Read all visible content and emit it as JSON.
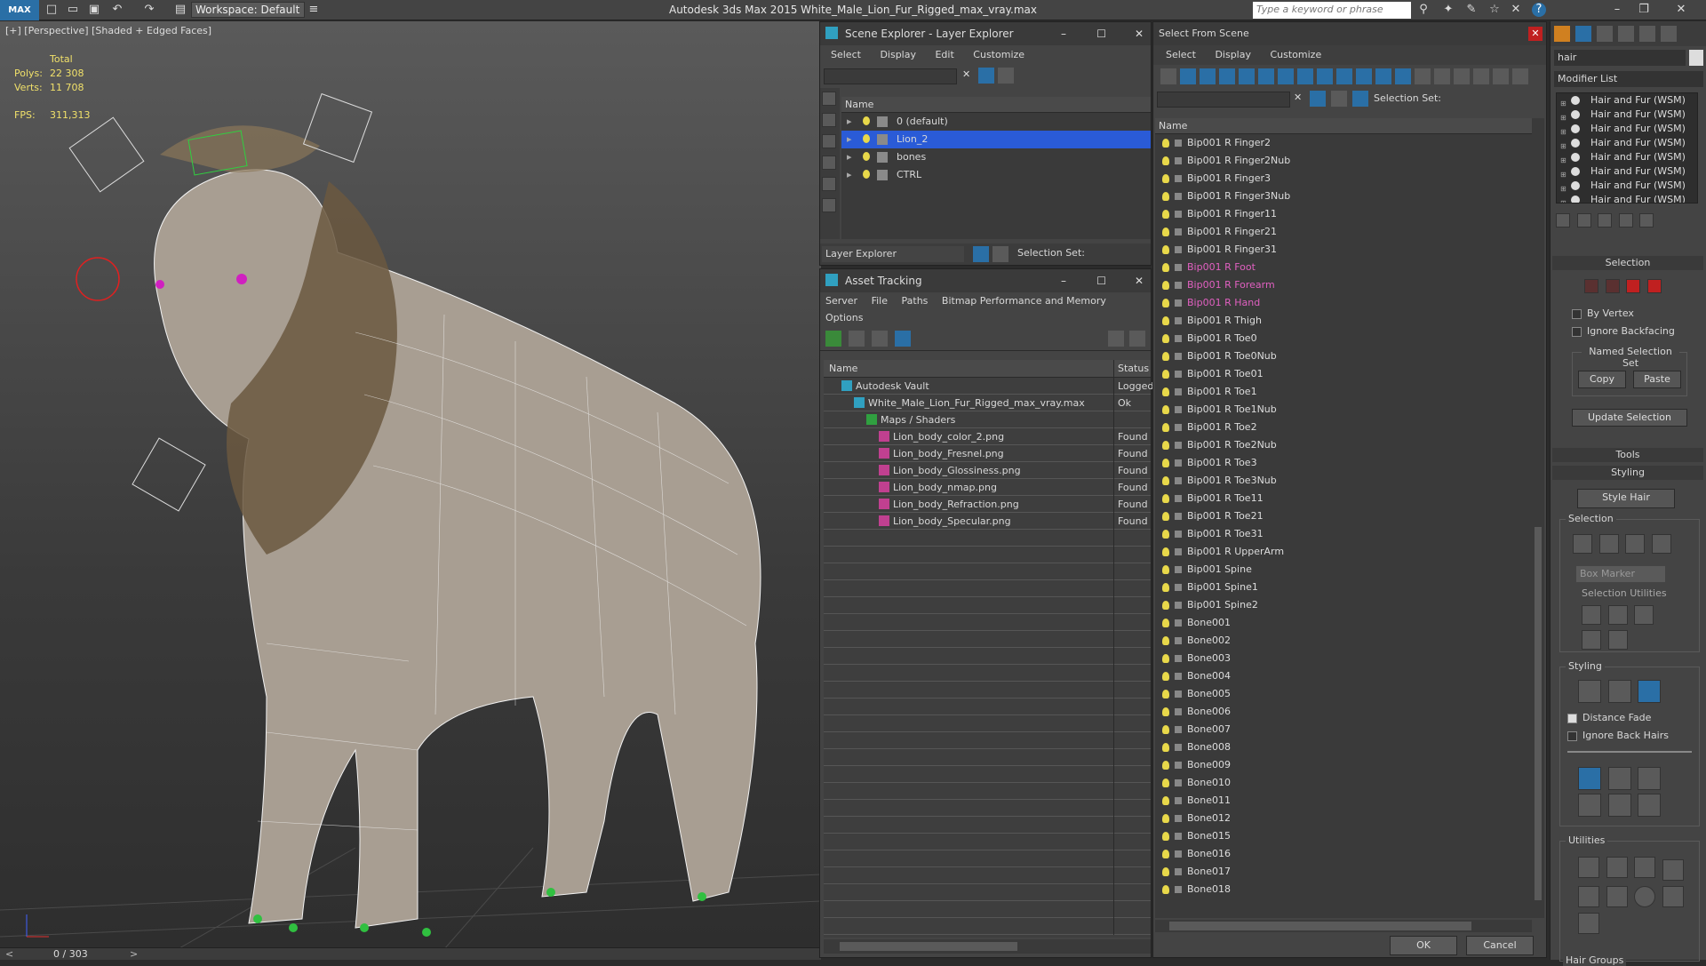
{
  "app": {
    "title": "Autodesk 3ds Max  2015     White_Male_Lion_Fur_Rigged_max_vray.max",
    "logo": "MAX",
    "workspace": "Workspace: Default",
    "search_placeholder": "Type a keyword or phrase"
  },
  "viewport": {
    "label": "[+] [Perspective] [Shaded + Edged Faces]",
    "stats": {
      "total_label": "Total",
      "polys_label": "Polys:",
      "polys": "22 308",
      "verts_label": "Verts:",
      "verts": "11 708",
      "fps_label": "FPS:",
      "fps": "311,313"
    },
    "timeline": "0 / 303"
  },
  "scene_explorer": {
    "title": "Scene Explorer - Layer Explorer",
    "menu": [
      "Select",
      "Display",
      "Edit",
      "Customize"
    ],
    "column": "Name",
    "layers": [
      {
        "name": "0 (default)",
        "selected": false
      },
      {
        "name": "Lion_2",
        "selected": true
      },
      {
        "name": "bones",
        "selected": false
      },
      {
        "name": "CTRL",
        "selected": false
      }
    ],
    "footer_dropdown": "Layer Explorer",
    "selection_set": "Selection Set:"
  },
  "asset_tracking": {
    "title": "Asset Tracking",
    "menu": [
      "Server",
      "File",
      "Paths",
      "Bitmap Performance and Memory"
    ],
    "menu2": "Options",
    "columns": [
      "Name",
      "Status"
    ],
    "rows": [
      {
        "name": "Autodesk Vault",
        "status": "Logged",
        "indent": 1
      },
      {
        "name": "White_Male_Lion_Fur_Rigged_max_vray.max",
        "status": "Ok",
        "indent": 2
      },
      {
        "name": "Maps / Shaders",
        "status": "",
        "indent": 3
      },
      {
        "name": "Lion_body_color_2.png",
        "status": "Found",
        "indent": 4
      },
      {
        "name": "Lion_body_Fresnel.png",
        "status": "Found",
        "indent": 4
      },
      {
        "name": "Lion_body_Glossiness.png",
        "status": "Found",
        "indent": 4
      },
      {
        "name": "Lion_body_nmap.png",
        "status": "Found",
        "indent": 4
      },
      {
        "name": "Lion_body_Refraction.png",
        "status": "Found",
        "indent": 4
      },
      {
        "name": "Lion_body_Specular.png",
        "status": "Found",
        "indent": 4
      }
    ]
  },
  "select_from_scene": {
    "title": "Select From Scene",
    "menu": [
      "Select",
      "Display",
      "Customize"
    ],
    "selection_set": "Selection Set:",
    "column": "Name",
    "items": [
      {
        "name": "Bip001 R Finger2",
        "hl": false
      },
      {
        "name": "Bip001 R Finger2Nub",
        "hl": false
      },
      {
        "name": "Bip001 R Finger3",
        "hl": false
      },
      {
        "name": "Bip001 R Finger3Nub",
        "hl": false
      },
      {
        "name": "Bip001 R Finger11",
        "hl": false
      },
      {
        "name": "Bip001 R Finger21",
        "hl": false
      },
      {
        "name": "Bip001 R Finger31",
        "hl": false
      },
      {
        "name": "Bip001 R Foot",
        "hl": true
      },
      {
        "name": "Bip001 R Forearm",
        "hl": true
      },
      {
        "name": "Bip001 R Hand",
        "hl": true
      },
      {
        "name": "Bip001 R Thigh",
        "hl": false
      },
      {
        "name": "Bip001 R Toe0",
        "hl": false
      },
      {
        "name": "Bip001 R Toe0Nub",
        "hl": false
      },
      {
        "name": "Bip001 R Toe01",
        "hl": false
      },
      {
        "name": "Bip001 R Toe1",
        "hl": false
      },
      {
        "name": "Bip001 R Toe1Nub",
        "hl": false
      },
      {
        "name": "Bip001 R Toe2",
        "hl": false
      },
      {
        "name": "Bip001 R Toe2Nub",
        "hl": false
      },
      {
        "name": "Bip001 R Toe3",
        "hl": false
      },
      {
        "name": "Bip001 R Toe3Nub",
        "hl": false
      },
      {
        "name": "Bip001 R Toe11",
        "hl": false
      },
      {
        "name": "Bip001 R Toe21",
        "hl": false
      },
      {
        "name": "Bip001 R Toe31",
        "hl": false
      },
      {
        "name": "Bip001 R UpperArm",
        "hl": false
      },
      {
        "name": "Bip001 Spine",
        "hl": false
      },
      {
        "name": "Bip001 Spine1",
        "hl": false
      },
      {
        "name": "Bip001 Spine2",
        "hl": false
      },
      {
        "name": "Bone001",
        "hl": false
      },
      {
        "name": "Bone002",
        "hl": false
      },
      {
        "name": "Bone003",
        "hl": false
      },
      {
        "name": "Bone004",
        "hl": false
      },
      {
        "name": "Bone005",
        "hl": false
      },
      {
        "name": "Bone006",
        "hl": false
      },
      {
        "name": "Bone007",
        "hl": false
      },
      {
        "name": "Bone008",
        "hl": false
      },
      {
        "name": "Bone009",
        "hl": false
      },
      {
        "name": "Bone010",
        "hl": false
      },
      {
        "name": "Bone011",
        "hl": false
      },
      {
        "name": "Bone012",
        "hl": false
      },
      {
        "name": "Bone015",
        "hl": false
      },
      {
        "name": "Bone016",
        "hl": false
      },
      {
        "name": "Bone017",
        "hl": false
      },
      {
        "name": "Bone018",
        "hl": false
      }
    ],
    "ok": "OK",
    "cancel": "Cancel"
  },
  "command_panel": {
    "object_name": "hair",
    "modifier_list": "Modifier List",
    "stack": [
      "Hair and Fur (WSM)",
      "Hair and Fur (WSM)",
      "Hair and Fur (WSM)",
      "Hair and Fur (WSM)",
      "Hair and Fur (WSM)",
      "Hair and Fur (WSM)",
      "Hair and Fur (WSM)",
      "Hair and Fur (WSM)"
    ],
    "selection_rollout": "Selection",
    "by_vertex": "By Vertex",
    "ignore_backfacing": "Ignore Backfacing",
    "named_selection_set": "Named Selection Set",
    "copy": "Copy",
    "paste": "Paste",
    "update_selection": "Update Selection",
    "tools_rollout": "Tools",
    "styling_rollout": "Styling",
    "style_hair": "Style Hair",
    "selection_group": "Selection",
    "box_marker": "Box Marker",
    "selection_utilities": "Selection Utilities",
    "styling_group": "Styling",
    "distance_fade": "Distance Fade",
    "ignore_back_hairs": "Ignore Back Hairs",
    "utilities_group": "Utilities",
    "hair_groups": "Hair Groups"
  },
  "colors": {
    "selected_row": "#2a5bd7",
    "highlight_text": "#e060c0",
    "accent": "#2a6fa6"
  }
}
